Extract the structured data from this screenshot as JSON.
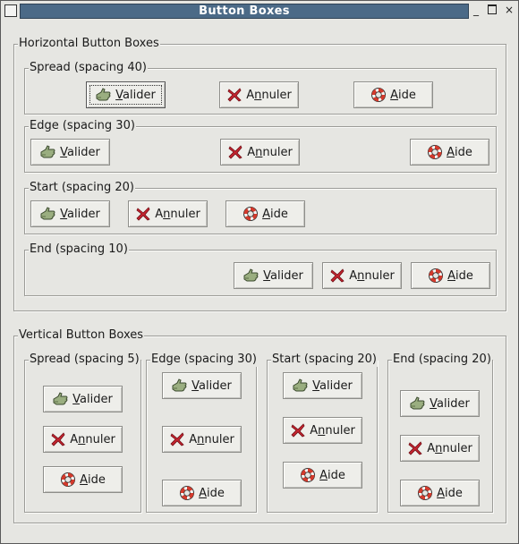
{
  "window": {
    "title": "Button Boxes"
  },
  "horizontal": {
    "label": "Horizontal Button Boxes",
    "frames": [
      {
        "label": "Spread (spacing 40)"
      },
      {
        "label": "Edge (spacing 30)"
      },
      {
        "label": "Start (spacing 20)"
      },
      {
        "label": "End (spacing 10)"
      }
    ]
  },
  "vertical": {
    "label": "Vertical Button Boxes",
    "frames": [
      {
        "label": "Spread (spacing 5)"
      },
      {
        "label": "Edge (spacing 30)"
      },
      {
        "label": "Start (spacing 20)"
      },
      {
        "label": "End (spacing 20)"
      }
    ]
  },
  "buttons": {
    "ok": {
      "mnemonic": "V",
      "rest": "alider",
      "icon": "ok-hand-icon"
    },
    "cancel": {
      "prefix": "A",
      "mnemonic": "n",
      "rest": "nuler",
      "icon": "cancel-x-icon"
    },
    "help": {
      "mnemonic": "A",
      "rest": "ide",
      "icon": "lifebuoy-help-icon"
    }
  },
  "colors": {
    "titlebar": "#4b6a87",
    "background": "#e6e6e2",
    "ok_icon": "#8aa06e",
    "cancel_icon": "#c0202a",
    "help_icon": "#d2402e"
  }
}
